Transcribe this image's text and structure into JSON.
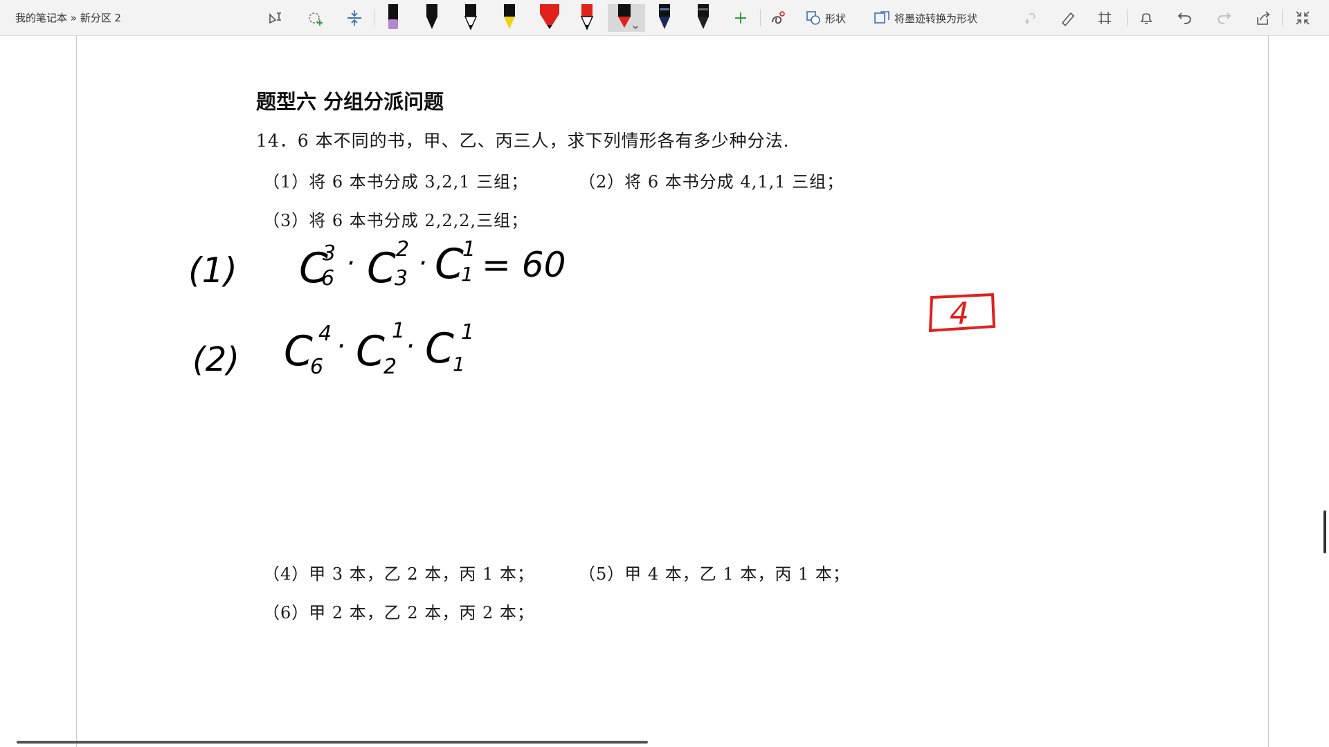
{
  "window": {
    "breadcrumb": "我的笔记本 » 新分区 2"
  },
  "toolbar": {
    "tools": [
      {
        "name": "lasso-select-icon"
      },
      {
        "name": "add-space-icon"
      },
      {
        "name": "insert-space-icon"
      },
      {
        "name": "pen-purple-highlighter",
        "color": "#b487d0"
      },
      {
        "name": "pen-black",
        "color": "#111111"
      },
      {
        "name": "pen-black-white-tip",
        "color": "#111111"
      },
      {
        "name": "pen-yellow",
        "color": "#f2d315"
      },
      {
        "name": "highlighter-red",
        "color": "#e0211c"
      },
      {
        "name": "pen-red-outline",
        "color": "#e0211c"
      },
      {
        "name": "pen-red-selected",
        "color": "#e0211c"
      },
      {
        "name": "pen-blue-dark",
        "color": "#1a2a5a"
      },
      {
        "name": "pen-dark-gray",
        "color": "#222222"
      }
    ],
    "shapes_label": "形状",
    "convert_label": "将墨迹转换为形状"
  },
  "page": {
    "heading": "题型六  分组分派问题",
    "question": "14．6 本不同的书，甲、乙、丙三人，求下列情形各有多少种分法.",
    "items": [
      "（1）将 6 本书分成 3,2,1 三组；",
      "（2）将 6 本书分成 4,1,1 三组；",
      "（3）将 6 本书分成 2,2,2,三组；",
      "（4）甲 3 本，乙 2 本，丙 1 本；",
      "（5）甲 4 本，乙 1 本，丙 1 本；",
      "（6）甲 2 本，乙 2 本，丙 2 本；"
    ]
  },
  "ink": {
    "line1_label": "(1)",
    "line2_label": "(2)",
    "line1_result": "= 60",
    "box_number": "4"
  }
}
